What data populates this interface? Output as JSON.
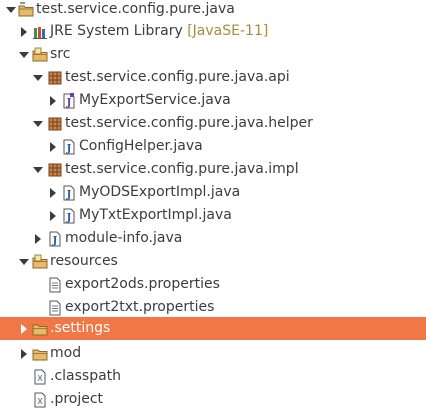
{
  "tree": {
    "root": {
      "label": "test.service.config.pure.java",
      "icon": "java-project-icon",
      "expanded": true
    },
    "jre": {
      "label": "JRE System Library",
      "decoration": "[JavaSE-11]",
      "icon": "library-icon",
      "expanded": false
    },
    "src": {
      "label": "src",
      "icon": "source-folder-icon",
      "expanded": true
    },
    "pkg_api": {
      "label": "test.service.config.pure.java.api",
      "icon": "package-icon",
      "expanded": true
    },
    "file_myexportservice": {
      "label": "MyExportService.java",
      "icon": "java-interface-file-icon",
      "expanded": false
    },
    "pkg_helper": {
      "label": "test.service.config.pure.java.helper",
      "icon": "package-icon",
      "expanded": true
    },
    "file_confighelper": {
      "label": "ConfigHelper.java",
      "icon": "java-file-icon",
      "expanded": false
    },
    "pkg_impl": {
      "label": "test.service.config.pure.java.impl",
      "icon": "package-icon",
      "expanded": true
    },
    "file_myodsexportimpl": {
      "label": "MyODSExportImpl.java",
      "icon": "java-file-icon",
      "expanded": false
    },
    "file_mytxtexportimpl": {
      "label": "MyTxtExportImpl.java",
      "icon": "java-file-icon",
      "expanded": false
    },
    "file_moduleinfo": {
      "label": "module-info.java",
      "icon": "java-file-icon",
      "expanded": false
    },
    "resources": {
      "label": "resources",
      "icon": "source-folder-icon",
      "expanded": true
    },
    "file_export2ods": {
      "label": "export2ods.properties",
      "icon": "properties-file-icon"
    },
    "file_export2txt": {
      "label": "export2txt.properties",
      "icon": "properties-file-icon"
    },
    "settings": {
      "label": ".settings",
      "icon": "folder-icon",
      "expanded": false,
      "selected": true
    },
    "mod": {
      "label": "mod",
      "icon": "folder-icon",
      "expanded": false
    },
    "file_classpath": {
      "label": ".classpath",
      "icon": "xml-file-icon"
    },
    "file_project": {
      "label": ".project",
      "icon": "xml-file-icon"
    }
  },
  "colors": {
    "selection": "#f07746",
    "decoration": "#a88b3c",
    "package": "#a0522d",
    "folder": "#e8b96a",
    "java_file_j": "#2a5ea8"
  }
}
